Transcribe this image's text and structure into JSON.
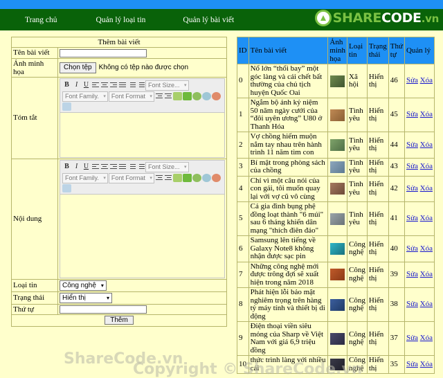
{
  "brand": {
    "logo_share": "SHARE",
    "logo_code": "CODE",
    "logo_vn": ".vn",
    "colors": {
      "topbar": "#1e90f5",
      "nav": "#096209",
      "body": "#ffffcc",
      "accent": "#1e90f5",
      "link": "#1414cf",
      "logo_green": "#7ac143"
    }
  },
  "nav": {
    "items": [
      {
        "label": "Trang chủ"
      },
      {
        "label": "Quản lý loại tin"
      },
      {
        "label": "Quản lý bài viết"
      }
    ]
  },
  "form": {
    "title": "Thêm bài viết",
    "fields": {
      "name_label": "Tên bài viết",
      "name_value": "",
      "image_label": "Ảnh minh họa",
      "file_button": "Chọn tệp",
      "file_status": "Không có tệp nào được chọn",
      "summary_label": "Tóm tắt",
      "summary_value": "",
      "content_label": "Nội dung",
      "content_value": "",
      "category_label": "Loại tin",
      "category_value": "Công nghệ",
      "status_label": "Trạng thái",
      "status_value": "Hiển thị",
      "order_label": "Thứ tự",
      "order_value": ""
    },
    "submit_label": "Thêm",
    "editor_toolbar": {
      "bold": "B",
      "italic": "I",
      "underline": "U",
      "font_size": "Font Size...",
      "font_family": "Font Family.",
      "font_format": "Font Format"
    }
  },
  "table": {
    "headers": {
      "id": "ID",
      "name": "Tên bài viết",
      "image": "Ảnh minh họa",
      "category": "Loại tin",
      "status": "Trạng thái",
      "order": "Thứ tự",
      "manage": "Quản lý"
    },
    "action_edit": "Sửa",
    "action_delete": "Xóa",
    "rows": [
      {
        "id": "0",
        "name": "Nổ lớn “thổi bay” một góc làng và cái chết bất thường của chủ tịch huyện Quốc Oai",
        "category": "Xã hội",
        "status": "Hiển thị",
        "order": "46"
      },
      {
        "id": "1",
        "name": "Ngắm bộ ảnh kỷ niệm 50 năm ngày cưới của “đôi uyên ương” U80 ở Thanh Hóa",
        "category": "Tình yêu",
        "status": "Hiển thị",
        "order": "45"
      },
      {
        "id": "2",
        "name": "Vợ chồng hiếm muộn nắm tay nhau trên hành trình 11 năm tìm con",
        "category": "Tình yêu",
        "status": "Hiển thị",
        "order": "44"
      },
      {
        "id": "3",
        "name": "Bí mật trong phòng sách của chồng",
        "category": "Tình yêu",
        "status": "Hiển thị",
        "order": "43"
      },
      {
        "id": "4",
        "name": "Chỉ vì một câu nói của con gái, tôi muốn quay lại với vợ cũ vô cùng",
        "category": "Tình yêu",
        "status": "Hiển thị",
        "order": "42"
      },
      {
        "id": "5",
        "name": "Cả gia đình bụng phệ đồng loạt thành \"6 múi\" sau 6 tháng khiến dân mạng \"thích điên đảo\"",
        "category": "Tình yêu",
        "status": "Hiển thị",
        "order": "41"
      },
      {
        "id": "6",
        "name": "Samsung lên tiếng về Galaxy Note8 không nhận được sạc pin",
        "category": "Công nghệ",
        "status": "Hiển thị",
        "order": "40"
      },
      {
        "id": "7",
        "name": "Những công nghệ mới được trông đợi sẽ xuất hiện trong năm 2018",
        "category": "Công nghệ",
        "status": "Hiển thị",
        "order": "39"
      },
      {
        "id": "8",
        "name": "Phát hiện lỗi bảo mật nghiêm trọng trên hàng tỷ máy tính và thiết bị di động",
        "category": "Công nghệ",
        "status": "Hiển thị",
        "order": "38"
      },
      {
        "id": "9",
        "name": "Điện thoại viền siêu mỏng của Sharp về Việt Nam với giá 6,9 triệu đồng",
        "category": "Công nghệ",
        "status": "Hiển thị",
        "order": "37"
      },
      {
        "id": "10",
        "name": "thức trình làng với nhiều cái",
        "category": "Công nghệ",
        "status": "Hiển thị",
        "order": "35"
      }
    ]
  },
  "watermarks": {
    "one": "ShareCode.vn",
    "two": "Copyright © ShareCode.vn"
  }
}
